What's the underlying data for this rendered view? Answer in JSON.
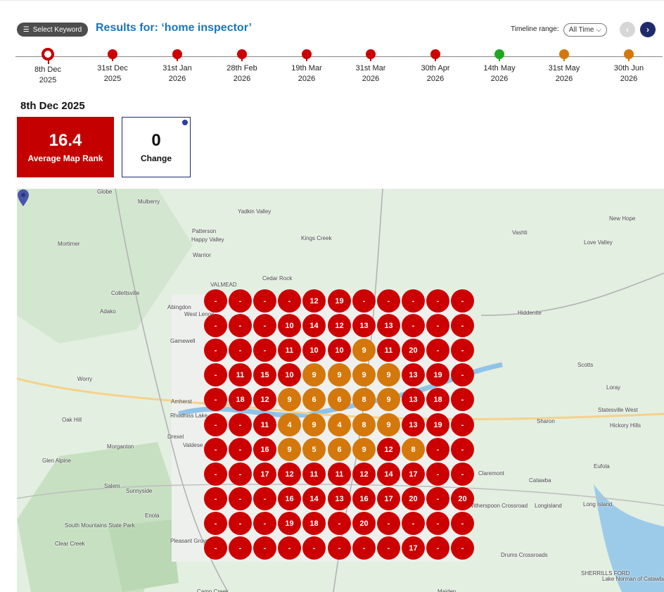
{
  "header": {
    "keyword_button_icon": "list-icon",
    "keyword_button_label": "Select Keyword",
    "results_title": "Results for: ‘home inspector’",
    "timeline_range_label": "Timeline range:",
    "timeline_range_value": "All Time",
    "prev_icon": "chevron-left-icon",
    "next_icon": "chevron-right-icon"
  },
  "timeline": [
    {
      "day": "8th Dec",
      "year": "2025",
      "status": "selected"
    },
    {
      "day": "31st Dec",
      "year": "2025",
      "status": "red"
    },
    {
      "day": "31st Jan",
      "year": "2026",
      "status": "red"
    },
    {
      "day": "28th Feb",
      "year": "2026",
      "status": "red"
    },
    {
      "day": "19th Mar",
      "year": "2026",
      "status": "red"
    },
    {
      "day": "31st Mar",
      "year": "2026",
      "status": "red"
    },
    {
      "day": "30th Apr",
      "year": "2026",
      "status": "red"
    },
    {
      "day": "14th May",
      "year": "2026",
      "status": "green"
    },
    {
      "day": "31st May",
      "year": "2026",
      "status": "orange"
    },
    {
      "day": "30th Jun",
      "year": "2026",
      "status": "orange"
    }
  ],
  "selected_date": "8th Dec 2025",
  "stats": {
    "average_rank_value": "16.4",
    "average_rank_label": "Average Map Rank",
    "change_value": "0",
    "change_label": "Change"
  },
  "colors": {
    "red": "#cc0000",
    "orange": "#d4780c",
    "green": "#1fa81f",
    "navy": "#1f2a6b",
    "title_blue": "#1b75bb"
  },
  "map": {
    "places": [
      "Globe",
      "Mulberry",
      "Yadkin Valley",
      "Patterson",
      "Happy Valley",
      "Warrior",
      "Kings Creek",
      "Vashti",
      "New Hope",
      "Mortimer",
      "Love Valley",
      "Collettsville",
      "Cedar Rock",
      "VALMEAD",
      "Adako",
      "Abingdon",
      "West Lenoir",
      "Hiddenite",
      "Gamewell",
      "Scotts",
      "Worry",
      "Amherst",
      "Rhodhiss Lake",
      "Loray",
      "Statesville West",
      "Oak Hill",
      "Drexel",
      "Sharon",
      "Hickory Hills",
      "Morganton",
      "Glen Alpine",
      "Valdese",
      "Eufola",
      "Claremont",
      "Catawba",
      "Salem",
      "Sunnyside",
      "Witherspoon Crossroad",
      "Longisland",
      "Long Island",
      "Enola",
      "South Mountains State Park",
      "Clear Creek",
      "Pleasant Grove",
      "Drums Crossroads",
      "SHERRILLS FORD",
      "Lake Norman of Catawba",
      "Camp Creek",
      "Maiden"
    ],
    "pin_icon": "map-pin-icon",
    "grid": [
      [
        {
          "v": "-",
          "c": "red"
        },
        {
          "v": "-",
          "c": "red"
        },
        {
          "v": "-",
          "c": "red"
        },
        {
          "v": "-",
          "c": "red"
        },
        {
          "v": "12",
          "c": "red"
        },
        {
          "v": "19",
          "c": "red"
        },
        {
          "v": "-",
          "c": "red"
        },
        {
          "v": "-",
          "c": "red"
        },
        {
          "v": "-",
          "c": "red"
        },
        {
          "v": "-",
          "c": "red"
        },
        {
          "v": "-",
          "c": "red"
        }
      ],
      [
        {
          "v": "-",
          "c": "red"
        },
        {
          "v": "-",
          "c": "red"
        },
        {
          "v": "-",
          "c": "red"
        },
        {
          "v": "10",
          "c": "red"
        },
        {
          "v": "14",
          "c": "red"
        },
        {
          "v": "12",
          "c": "red"
        },
        {
          "v": "13",
          "c": "red"
        },
        {
          "v": "13",
          "c": "red"
        },
        {
          "v": "-",
          "c": "red"
        },
        {
          "v": "-",
          "c": "red"
        },
        {
          "v": "-",
          "c": "red"
        }
      ],
      [
        {
          "v": "-",
          "c": "red"
        },
        {
          "v": "-",
          "c": "red"
        },
        {
          "v": "-",
          "c": "red"
        },
        {
          "v": "11",
          "c": "red"
        },
        {
          "v": "10",
          "c": "red"
        },
        {
          "v": "10",
          "c": "red"
        },
        {
          "v": "9",
          "c": "orange"
        },
        {
          "v": "11",
          "c": "red"
        },
        {
          "v": "20",
          "c": "red"
        },
        {
          "v": "-",
          "c": "red"
        },
        {
          "v": "-",
          "c": "red"
        }
      ],
      [
        {
          "v": "-",
          "c": "red"
        },
        {
          "v": "11",
          "c": "red"
        },
        {
          "v": "15",
          "c": "red"
        },
        {
          "v": "10",
          "c": "red"
        },
        {
          "v": "9",
          "c": "orange"
        },
        {
          "v": "9",
          "c": "orange"
        },
        {
          "v": "9",
          "c": "orange"
        },
        {
          "v": "9",
          "c": "orange"
        },
        {
          "v": "13",
          "c": "red"
        },
        {
          "v": "19",
          "c": "red"
        },
        {
          "v": "-",
          "c": "red"
        }
      ],
      [
        {
          "v": "-",
          "c": "red"
        },
        {
          "v": "18",
          "c": "red"
        },
        {
          "v": "12",
          "c": "red"
        },
        {
          "v": "9",
          "c": "orange"
        },
        {
          "v": "6",
          "c": "orange"
        },
        {
          "v": "6",
          "c": "orange"
        },
        {
          "v": "8",
          "c": "orange"
        },
        {
          "v": "9",
          "c": "orange"
        },
        {
          "v": "13",
          "c": "red"
        },
        {
          "v": "18",
          "c": "red"
        },
        {
          "v": "-",
          "c": "red"
        }
      ],
      [
        {
          "v": "-",
          "c": "red"
        },
        {
          "v": "-",
          "c": "red"
        },
        {
          "v": "11",
          "c": "red"
        },
        {
          "v": "4",
          "c": "orange"
        },
        {
          "v": "9",
          "c": "orange"
        },
        {
          "v": "4",
          "c": "orange"
        },
        {
          "v": "8",
          "c": "orange"
        },
        {
          "v": "9",
          "c": "orange"
        },
        {
          "v": "13",
          "c": "red"
        },
        {
          "v": "19",
          "c": "red"
        },
        {
          "v": "-",
          "c": "red"
        }
      ],
      [
        {
          "v": "-",
          "c": "red"
        },
        {
          "v": "-",
          "c": "red"
        },
        {
          "v": "16",
          "c": "red"
        },
        {
          "v": "9",
          "c": "orange"
        },
        {
          "v": "5",
          "c": "orange"
        },
        {
          "v": "6",
          "c": "orange"
        },
        {
          "v": "9",
          "c": "orange"
        },
        {
          "v": "12",
          "c": "red"
        },
        {
          "v": "8",
          "c": "orange"
        },
        {
          "v": "-",
          "c": "red"
        },
        {
          "v": "-",
          "c": "red"
        }
      ],
      [
        {
          "v": "-",
          "c": "red"
        },
        {
          "v": "-",
          "c": "red"
        },
        {
          "v": "17",
          "c": "red"
        },
        {
          "v": "12",
          "c": "red"
        },
        {
          "v": "11",
          "c": "red"
        },
        {
          "v": "11",
          "c": "red"
        },
        {
          "v": "12",
          "c": "red"
        },
        {
          "v": "14",
          "c": "red"
        },
        {
          "v": "17",
          "c": "red"
        },
        {
          "v": "-",
          "c": "red"
        },
        {
          "v": "-",
          "c": "red"
        }
      ],
      [
        {
          "v": "-",
          "c": "red"
        },
        {
          "v": "-",
          "c": "red"
        },
        {
          "v": "-",
          "c": "red"
        },
        {
          "v": "16",
          "c": "red"
        },
        {
          "v": "14",
          "c": "red"
        },
        {
          "v": "13",
          "c": "red"
        },
        {
          "v": "16",
          "c": "red"
        },
        {
          "v": "17",
          "c": "red"
        },
        {
          "v": "20",
          "c": "red"
        },
        {
          "v": "-",
          "c": "red"
        },
        {
          "v": "20",
          "c": "red"
        }
      ],
      [
        {
          "v": "-",
          "c": "red"
        },
        {
          "v": "-",
          "c": "red"
        },
        {
          "v": "-",
          "c": "red"
        },
        {
          "v": "19",
          "c": "red"
        },
        {
          "v": "18",
          "c": "red"
        },
        {
          "v": "-",
          "c": "red"
        },
        {
          "v": "20",
          "c": "red"
        },
        {
          "v": "-",
          "c": "red"
        },
        {
          "v": "-",
          "c": "red"
        },
        {
          "v": "-",
          "c": "red"
        },
        {
          "v": "-",
          "c": "red"
        }
      ],
      [
        {
          "v": "-",
          "c": "red"
        },
        {
          "v": "-",
          "c": "red"
        },
        {
          "v": "-",
          "c": "red"
        },
        {
          "v": "-",
          "c": "red"
        },
        {
          "v": "-",
          "c": "red"
        },
        {
          "v": "-",
          "c": "red"
        },
        {
          "v": "-",
          "c": "red"
        },
        {
          "v": "-",
          "c": "red"
        },
        {
          "v": "17",
          "c": "red"
        },
        {
          "v": "-",
          "c": "red"
        },
        {
          "v": "-",
          "c": "red"
        }
      ]
    ]
  }
}
